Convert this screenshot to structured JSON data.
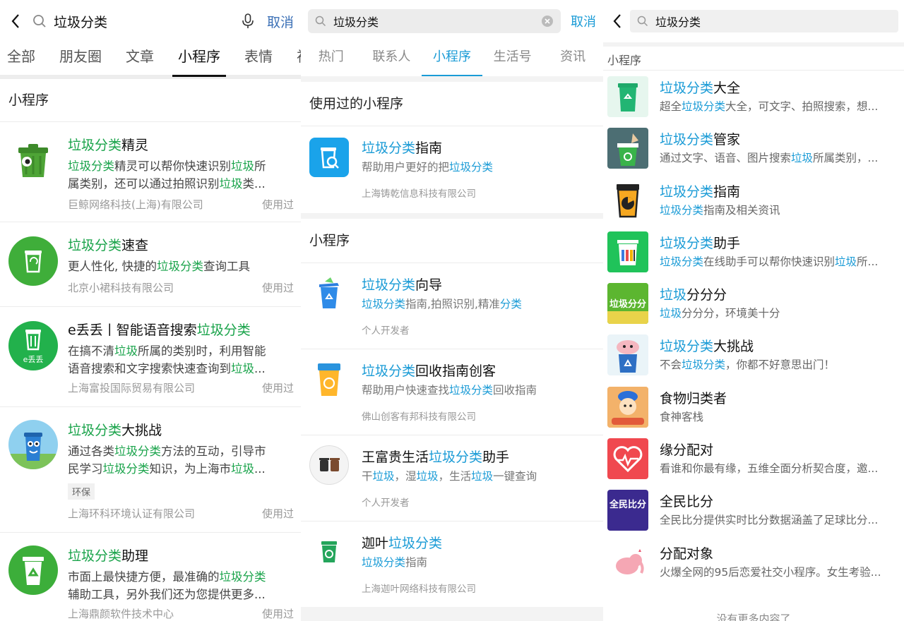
{
  "p1": {
    "query": "垃圾分类",
    "cancel": "取消",
    "tabs": [
      "全部",
      "朋友圈",
      "文章",
      "小程序",
      "表情",
      "视"
    ],
    "section": "小程序",
    "items": [
      {
        "name_hl": "垃圾分类",
        "name_rest": "精灵",
        "d1": [
          [
            "垃圾分类",
            "g"
          ],
          [
            "精灵可以帮你快速识别",
            ""
          ],
          [
            "垃圾",
            "g"
          ],
          [
            "所",
            ""
          ]
        ],
        "d2": [
          [
            "属类别，还可以通过拍照识别",
            ""
          ],
          [
            "垃圾",
            "g"
          ],
          [
            "类...",
            ""
          ]
        ],
        "company": "巨鲸网络科技(上海)有限公司",
        "used": "使用过"
      },
      {
        "name_hl": "垃圾分类",
        "name_rest": "速查",
        "d1": [
          [
            "更人性化, 快捷的",
            ""
          ],
          [
            "垃圾分类",
            "g"
          ],
          [
            "查询工具",
            ""
          ]
        ],
        "d2": [],
        "company": "北京小裙科技有限公司",
        "used": "使用过"
      },
      {
        "name_pre": "e丢丢丨智能语音搜索",
        "name_hl": "垃圾分类",
        "name_rest": "",
        "d1": [
          [
            "在搞不清",
            ""
          ],
          [
            "垃圾",
            "g"
          ],
          [
            "所属的类别时，利用智能",
            ""
          ]
        ],
        "d2": [
          [
            "语音搜索和文字搜索快速查询到",
            ""
          ],
          [
            "垃圾",
            "g"
          ],
          [
            "...",
            ""
          ]
        ],
        "company": "上海富投国际贸易有限公司",
        "used": "使用过",
        "icon_text": "e丢丢"
      },
      {
        "name_hl": "垃圾分类",
        "name_rest": "大挑战",
        "d1": [
          [
            "通过各类",
            ""
          ],
          [
            "垃圾分类",
            "g"
          ],
          [
            "方法的互动，引导市",
            ""
          ]
        ],
        "d2": [
          [
            "民学习",
            ""
          ],
          [
            "垃圾分类",
            "g"
          ],
          [
            "知识，为上海市",
            ""
          ],
          [
            "垃圾",
            "g"
          ],
          [
            "...",
            ""
          ]
        ],
        "tag": "环保",
        "company": "上海环科环境认证有限公司",
        "used": "使用过"
      },
      {
        "name_hl": "垃圾分类",
        "name_rest": "助理",
        "d1": [
          [
            "市面上最快捷方便，最准确的",
            ""
          ],
          [
            "垃圾分类",
            "g"
          ]
        ],
        "d2": [
          [
            "辅助工具，另外我们还为您提供更多...",
            ""
          ]
        ],
        "company": "上海鼎颜软件技术中心",
        "used": "使用过"
      }
    ]
  },
  "p2": {
    "query": "垃圾分类",
    "cancel": "取消",
    "tabs": [
      "热门",
      "联系人",
      "小程序",
      "生活号",
      "资讯"
    ],
    "section_used": "使用过的小程序",
    "used_item": {
      "name_hl": "垃圾分类",
      "name_rest": "指南",
      "desc": [
        [
          "帮助用户更好的把",
          ""
        ],
        [
          "垃圾分类",
          "b"
        ]
      ],
      "company": "上海铸乾信息科技有限公司"
    },
    "section": "小程序",
    "items": [
      {
        "name_pre": "",
        "name_hl": "垃圾分类",
        "name_rest": "向导",
        "desc": [
          [
            "垃圾分类",
            "b"
          ],
          [
            "指南,拍照识别,精准",
            ""
          ],
          [
            "分类",
            "b"
          ]
        ],
        "company": "个人开发者"
      },
      {
        "name_pre": "",
        "name_hl": "垃圾分类",
        "name_rest": "回收指南创客",
        "desc": [
          [
            "帮助用户快速查找",
            ""
          ],
          [
            "垃圾分类",
            "b"
          ],
          [
            "回收指南",
            ""
          ]
        ],
        "company": "佛山创客有邦科技有限公司"
      },
      {
        "name_pre": "王富贵生活",
        "name_hl": "垃圾分类",
        "name_rest": "助手",
        "desc": [
          [
            "干",
            ""
          ],
          [
            "垃圾",
            "b"
          ],
          [
            "，湿",
            ""
          ],
          [
            "垃圾",
            "b"
          ],
          [
            "，生活",
            ""
          ],
          [
            "垃圾",
            "b"
          ],
          [
            "一键查询",
            ""
          ]
        ],
        "company": "个人开发者"
      },
      {
        "name_pre": "迦叶",
        "name_hl": "垃圾分类",
        "name_rest": "",
        "desc": [
          [
            "垃圾分类",
            "b"
          ],
          [
            "指南",
            ""
          ]
        ],
        "company": "上海迦叶网络科技有限公司"
      }
    ]
  },
  "p3": {
    "query": "垃圾分类",
    "section": "小程序",
    "items": [
      {
        "name": [
          [
            "垃圾分类",
            "b"
          ],
          [
            "大全",
            ""
          ]
        ],
        "desc": [
          [
            "超全",
            ""
          ],
          [
            "垃圾分类",
            "b"
          ],
          [
            "大全，可文字、拍照搜索，想...",
            ""
          ]
        ]
      },
      {
        "name": [
          [
            "垃圾分类",
            "b"
          ],
          [
            "管家",
            ""
          ]
        ],
        "desc": [
          [
            "通过文字、语音、图片搜索",
            ""
          ],
          [
            "垃圾",
            "b"
          ],
          [
            "所属类别，...",
            ""
          ]
        ]
      },
      {
        "name": [
          [
            "垃圾分类",
            "b"
          ],
          [
            "指南",
            ""
          ]
        ],
        "desc": [
          [
            "垃圾分类",
            "b"
          ],
          [
            "指南及相关资讯",
            ""
          ]
        ]
      },
      {
        "name": [
          [
            "垃圾分类",
            "b"
          ],
          [
            "助手",
            ""
          ]
        ],
        "desc": [
          [
            "垃圾分类",
            "b"
          ],
          [
            "在线助手可以帮你快速识别",
            ""
          ],
          [
            "垃圾",
            "b"
          ],
          [
            "所...",
            ""
          ]
        ]
      },
      {
        "name": [
          [
            "垃圾",
            "b"
          ],
          [
            "分分分",
            ""
          ]
        ],
        "desc": [
          [
            "垃圾",
            "b"
          ],
          [
            "分分分，环境美十分",
            ""
          ]
        ],
        "icon_text": "垃圾分分"
      },
      {
        "name": [
          [
            "垃圾分类",
            "b"
          ],
          [
            "大挑战",
            ""
          ]
        ],
        "desc": [
          [
            "不会",
            ""
          ],
          [
            "垃圾分类",
            "b"
          ],
          [
            "，你都不好意思出门！",
            ""
          ]
        ]
      },
      {
        "name": [
          [
            "食物归类者",
            ""
          ]
        ],
        "desc": [
          [
            "食神客栈",
            ""
          ]
        ]
      },
      {
        "name": [
          [
            "缘分配对",
            ""
          ]
        ],
        "desc": [
          [
            "看谁和你最有缘，五维全面分析契合度，邀...",
            ""
          ]
        ]
      },
      {
        "name": [
          [
            "全民比分",
            ""
          ]
        ],
        "desc": [
          [
            "全民比分提供实时比分数据涵盖了足球比分...",
            ""
          ]
        ],
        "icon_text": "全民比分"
      },
      {
        "name": [
          [
            "分配对象",
            ""
          ]
        ],
        "desc": [
          [
            "火爆全网的95后恋爱社交小程序。女生考验...",
            ""
          ]
        ]
      }
    ],
    "no_more": "没有更多内容了"
  }
}
